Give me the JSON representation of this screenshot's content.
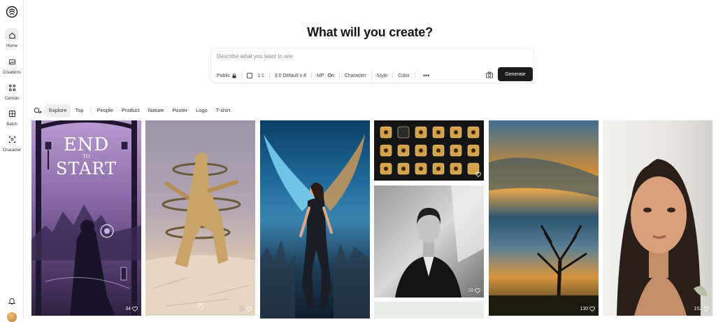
{
  "sidebar": {
    "items": [
      {
        "label": "Home",
        "icon": "home-icon"
      },
      {
        "label": "Creations",
        "icon": "images-icon"
      },
      {
        "label": "Canvas",
        "icon": "canvas-icon"
      },
      {
        "label": "Batch",
        "icon": "batch-icon"
      },
      {
        "label": "Character",
        "icon": "character-icon"
      }
    ]
  },
  "headline": "What will you create?",
  "prompt": {
    "placeholder": "Describe what you want to see",
    "visibility": "Public",
    "aspect": "1:1",
    "model": "3.0 Default x 4",
    "mp_label": "MP",
    "mp_value": "On",
    "character": "Character",
    "style": "Style",
    "color": "Color",
    "more": "•••",
    "generate": "Generate"
  },
  "tabs": [
    "Explore",
    "Top",
    "People",
    "Product",
    "Nature",
    "Poster",
    "Logo",
    "T-shirt"
  ],
  "gallery": {
    "poster_title_top": "END",
    "poster_title_mid": "TO",
    "poster_title_bottom": "START",
    "statue_signature": "PJ",
    "likes": {
      "poster": "34",
      "statue": "26",
      "icons": "",
      "portrait_man": "28",
      "landscape": "130",
      "portrait_woman": "152"
    }
  },
  "colors": {
    "accent_dark": "#1b1b1b",
    "active_bg": "#efefef"
  }
}
